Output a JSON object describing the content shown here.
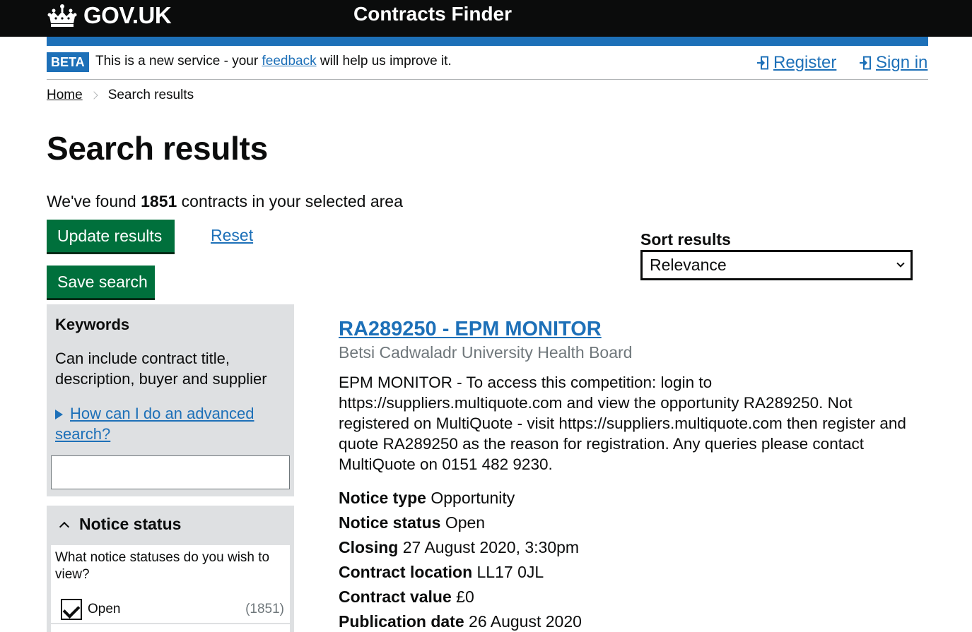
{
  "header": {
    "logo_text": "GOV.UK",
    "service_name": "Contracts Finder"
  },
  "phase_banner": {
    "tag": "BETA",
    "text_before": "This is a new service - your ",
    "link": "feedback",
    "text_after": " will help us improve it.",
    "register": "Register",
    "sign_in": "Sign in"
  },
  "breadcrumb": {
    "home": "Home",
    "current": "Search results"
  },
  "page": {
    "title": "Search results",
    "found_prefix": "We've found ",
    "found_count": "1851",
    "found_suffix": " contracts in your selected area",
    "update_button": "Update results",
    "reset_link": "Reset",
    "save_button": "Save search"
  },
  "sort": {
    "label": "Sort results",
    "selected": "Relevance"
  },
  "filters": {
    "keywords": {
      "title": "Keywords",
      "hint": "Can include contract title, description, buyer and supplier",
      "advanced_link": "How can I do an advanced search?",
      "value": ""
    },
    "notice_status": {
      "title": "Notice status",
      "question": "What notice statuses do you wish to view?",
      "options": [
        {
          "label": "Open",
          "count": "(1851)",
          "checked": true
        }
      ]
    }
  },
  "results": [
    {
      "title": "RA289250 - EPM MONITOR",
      "buyer": "Betsi Cadwaladr University Health Board",
      "description": "EPM MONITOR - To access this competition: login to https://suppliers.multiquote.com and view the opportunity RA289250. Not registered on MultiQuote - visit https://suppliers.multiquote.com then register and quote RA289250 as the reason for registration. Any queries please contact MultiQuote on 0151 482 9230.",
      "meta": [
        {
          "label": "Notice type",
          "value": "Opportunity"
        },
        {
          "label": "Notice status",
          "value": "Open"
        },
        {
          "label": "Closing",
          "value": "27 August 2020, 3:30pm"
        },
        {
          "label": "Contract location",
          "value": "LL17 0JL"
        },
        {
          "label": "Contract value",
          "value": "£0"
        },
        {
          "label": "Publication date",
          "value": "26 August 2020"
        }
      ]
    }
  ],
  "colors": {
    "header_bg": "#0b0c0c",
    "link": "#1d70b8",
    "button": "#00703c",
    "panel": "#dee0e2"
  }
}
